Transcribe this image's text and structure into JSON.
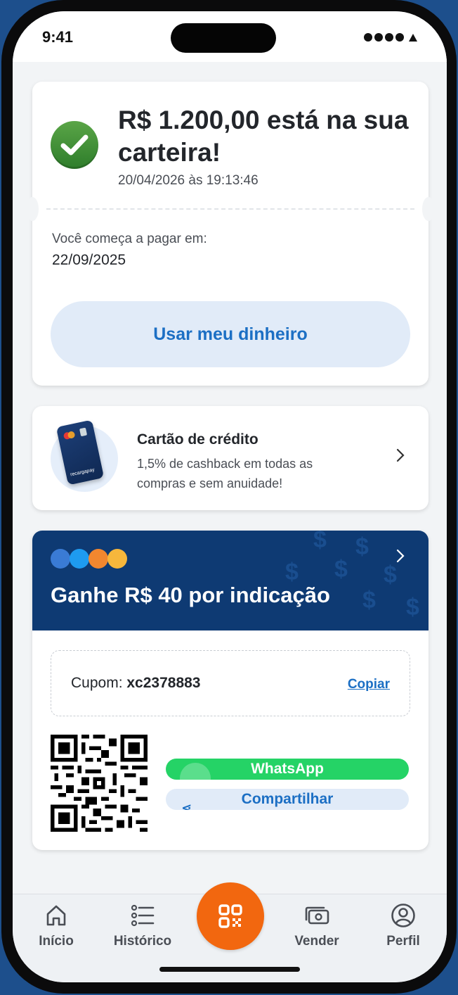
{
  "status_bar": {
    "time": "9:41"
  },
  "success": {
    "title": "R$ 1.200,00 está na sua carteira!",
    "datetime": "20/04/2026 às 19:13:46",
    "payment_label": "Você começa a pagar em:",
    "payment_date": "22/09/2025",
    "button_label": "Usar meu dinheiro"
  },
  "credit_card": {
    "title": "Cartão de crédito",
    "description": "1,5% de cashback em todas as compras e sem anuidade!",
    "card_brand": "recargapay"
  },
  "referral": {
    "title": "Ganhe R$ 40 por indicação",
    "coupon_label": "Cupom:",
    "coupon_code": "xc2378883",
    "copy_label": "Copiar",
    "whatsapp_label": "WhatsApp",
    "share_label": "Compartilhar",
    "avatar_colors": [
      "#3a7bd5",
      "#1e9bf0",
      "#f2872f",
      "#f6b73c"
    ]
  },
  "nav": {
    "items": [
      {
        "label": "Início",
        "icon": "home-icon"
      },
      {
        "label": "Histórico",
        "icon": "list-icon"
      },
      {
        "label": "Vender",
        "icon": "money-icon"
      },
      {
        "label": "Perfil",
        "icon": "profile-icon"
      }
    ],
    "center_icon": "qr-code-icon"
  },
  "colors": {
    "accent_blue": "#1c6fc4",
    "banner_navy": "#0e3a73",
    "success_green": "#2e7d2b",
    "whatsapp_green": "#25d366",
    "fab_orange": "#f2670f"
  }
}
